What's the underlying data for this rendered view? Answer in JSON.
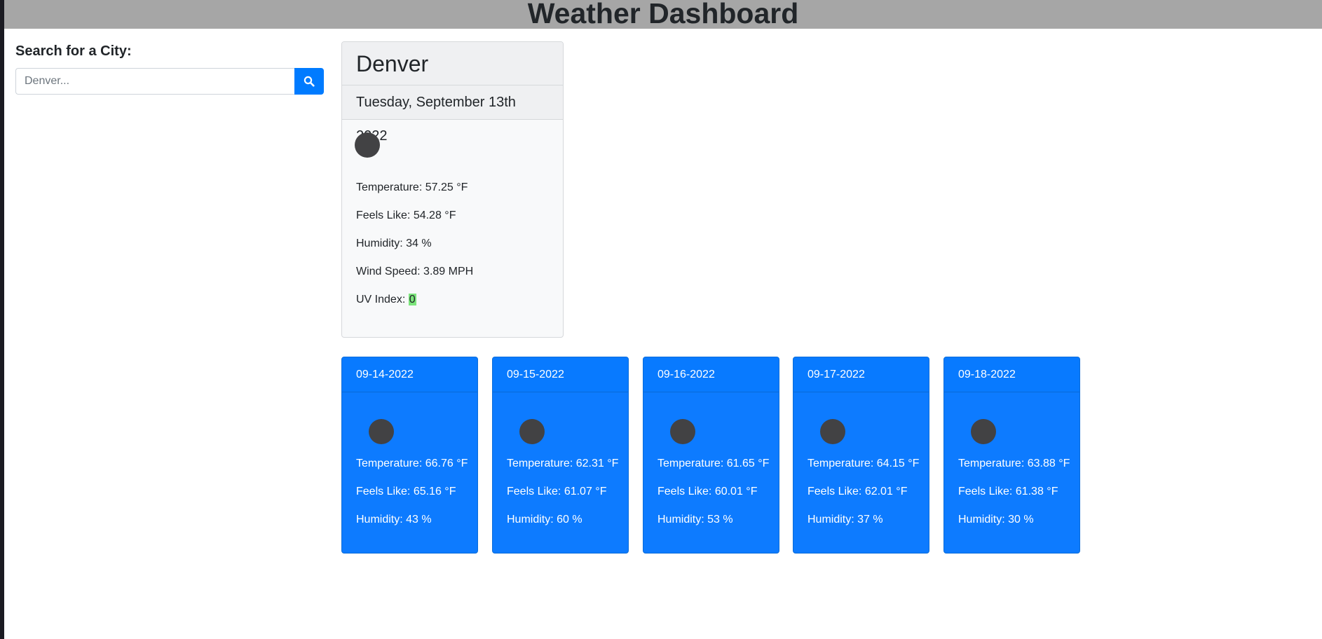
{
  "header": {
    "title": "Weather Dashboard"
  },
  "search": {
    "label": "Search for a City:",
    "placeholder": "Denver...",
    "button_icon": "search-icon"
  },
  "today": {
    "city": "Denver",
    "date": "Tuesday, September 13th 2022",
    "icon": "weather-icon",
    "temperature": "Temperature: 57.25 °F",
    "feels_like": "Feels Like: 54.28 °F",
    "humidity": "Humidity: 34 %",
    "wind": "Wind Speed: 3.89 MPH",
    "uv_label": "UV Index: ",
    "uv_value": "0",
    "uv_color": "#7ce57c"
  },
  "forecast": [
    {
      "date": "09-14-2022",
      "temperature": "Temperature: 66.76 °F",
      "feels_like": "Feels Like: 65.16 °F",
      "humidity": "Humidity: 43 %"
    },
    {
      "date": "09-15-2022",
      "temperature": "Temperature: 62.31 °F",
      "feels_like": "Feels Like: 61.07 °F",
      "humidity": "Humidity: 60 %"
    },
    {
      "date": "09-16-2022",
      "temperature": "Temperature: 61.65 °F",
      "feels_like": "Feels Like: 60.01 °F",
      "humidity": "Humidity: 53 %"
    },
    {
      "date": "09-17-2022",
      "temperature": "Temperature: 64.15 °F",
      "feels_like": "Feels Like: 62.01 °F",
      "humidity": "Humidity: 37 %"
    },
    {
      "date": "09-18-2022",
      "temperature": "Temperature: 63.88 °F",
      "feels_like": "Feels Like: 61.38 °F",
      "humidity": "Humidity: 30 %"
    }
  ],
  "colors": {
    "header_bg": "#a6a6a6",
    "accent": "#007bff",
    "forecast_bg": "#0d7bff"
  }
}
